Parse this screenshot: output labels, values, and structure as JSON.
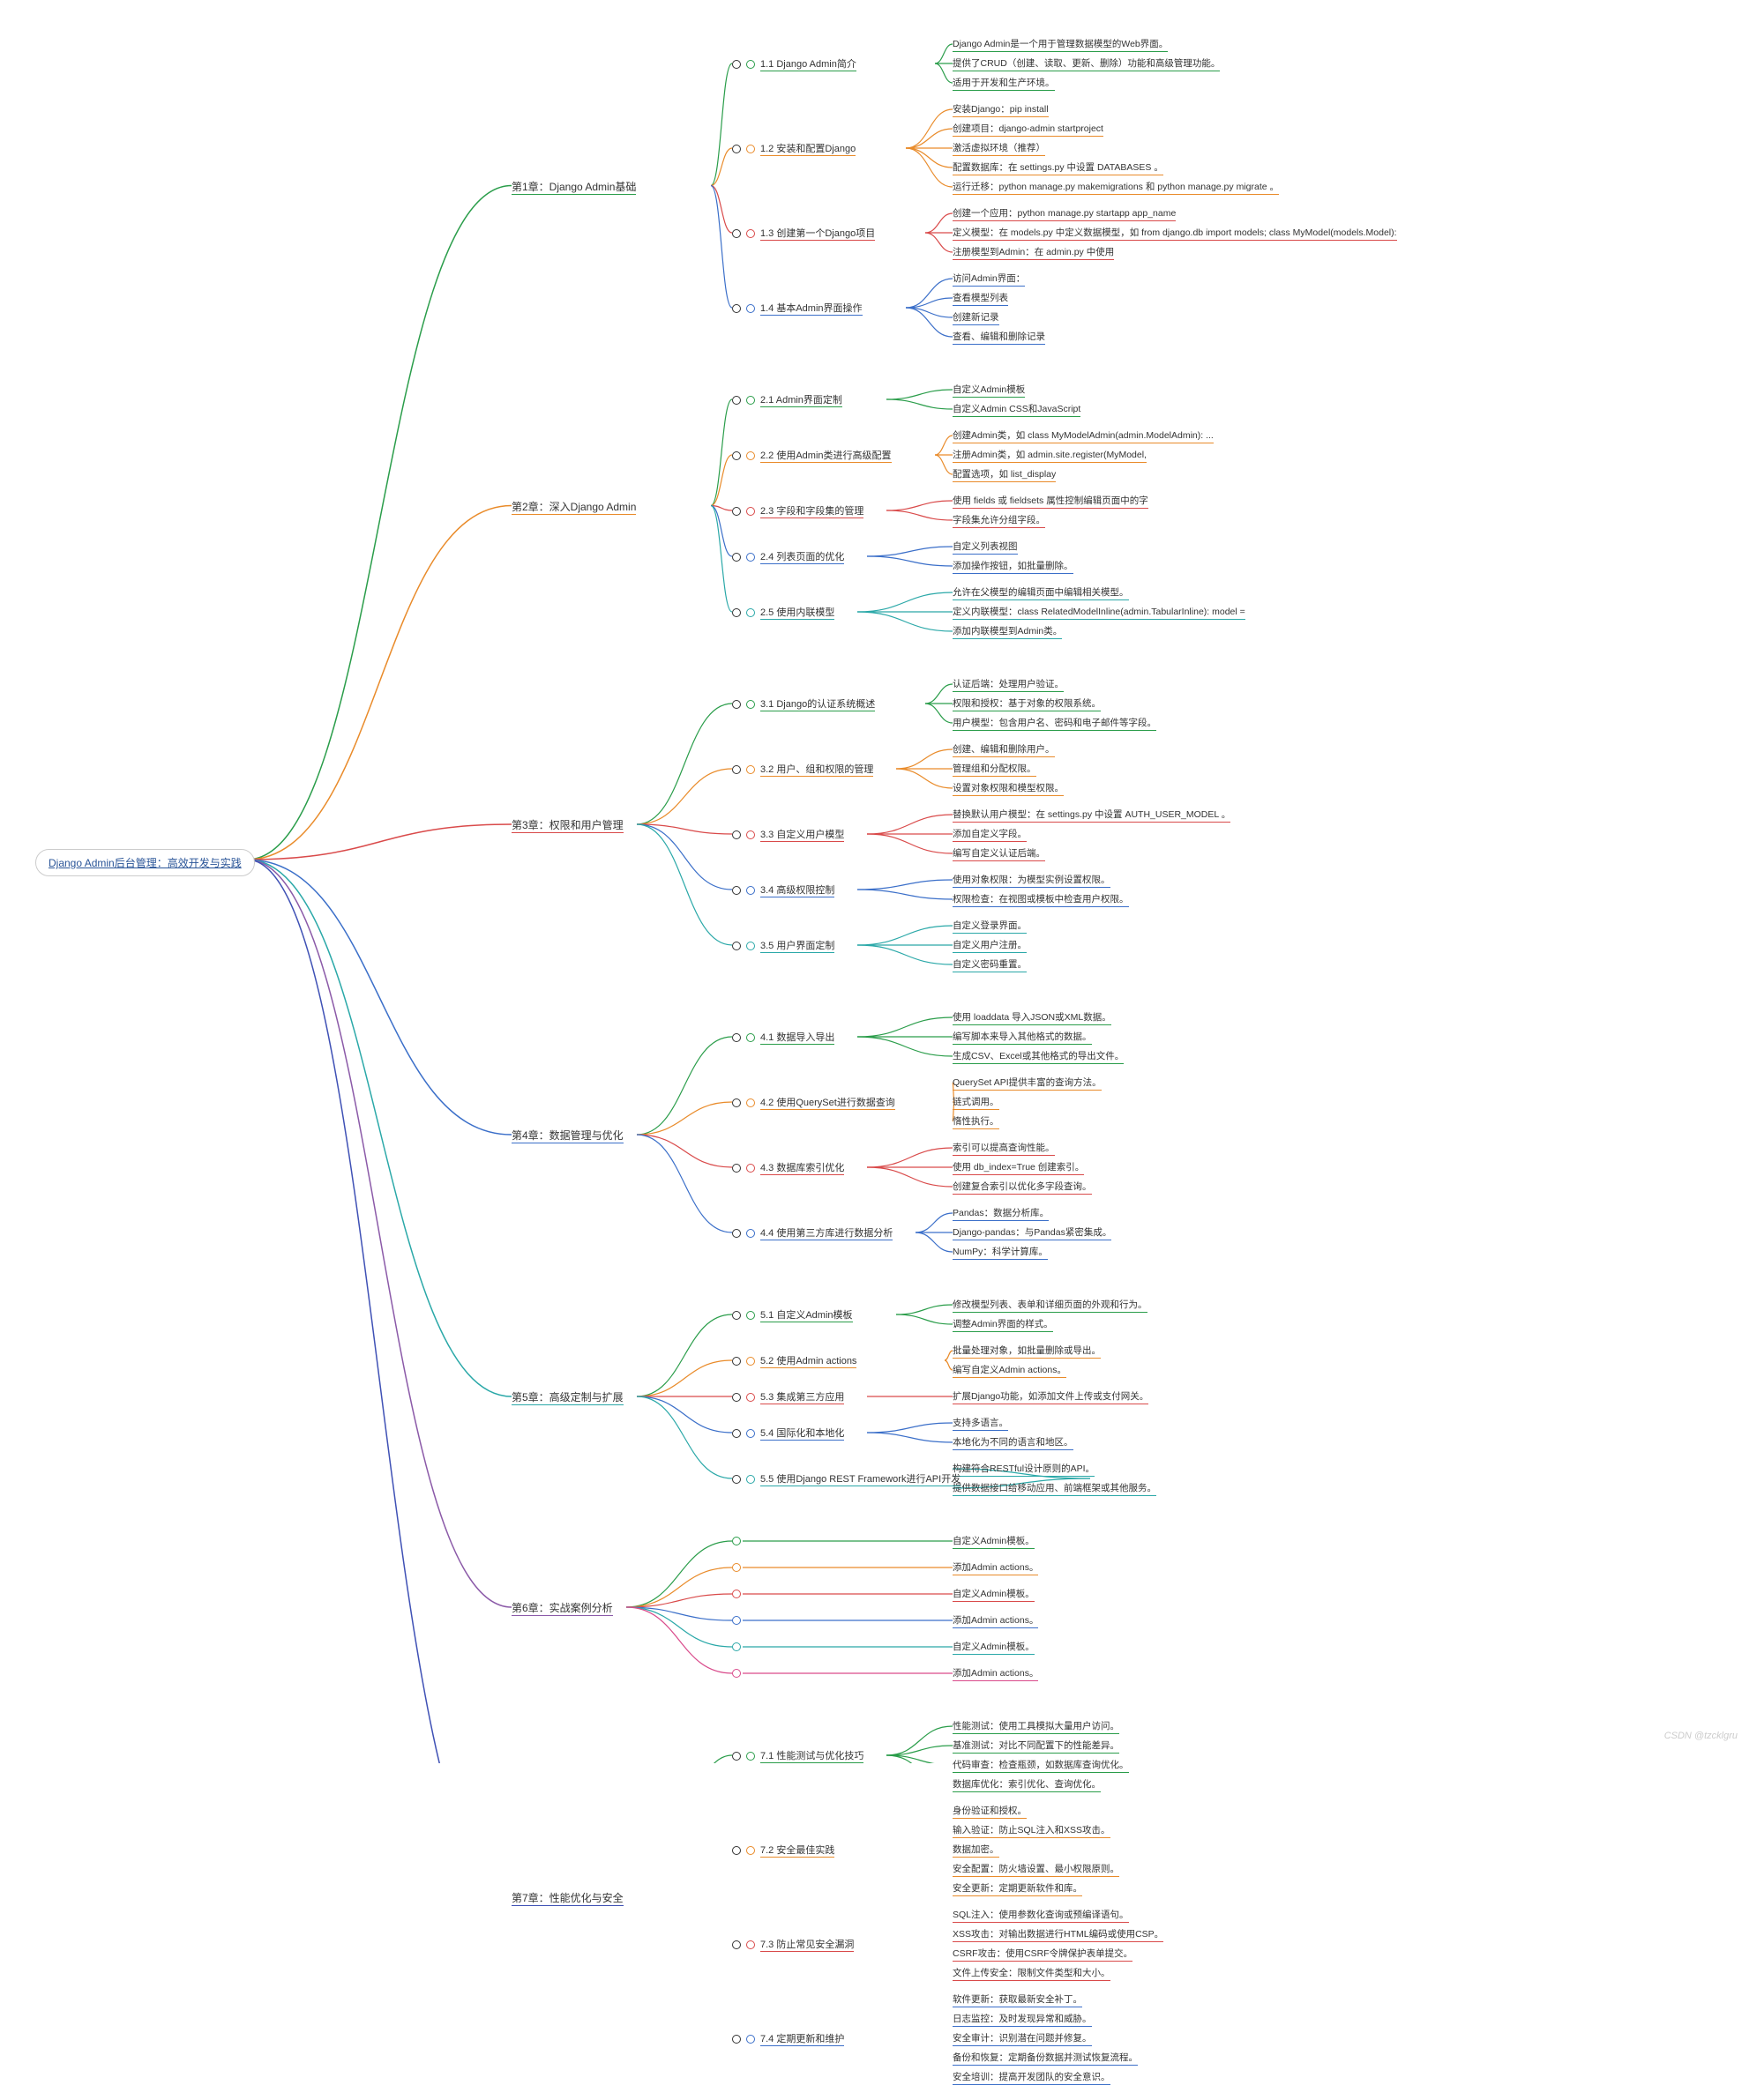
{
  "root": "Django Admin后台管理：高效开发与实践",
  "watermark": "CSDN @tzcklgru",
  "chapters": [
    {
      "label": "第1章：Django Admin基础",
      "color": "c-green",
      "sections": [
        {
          "label": "1.1 Django Admin简介",
          "color": "c-green",
          "leaves": [
            "Django Admin是一个用于管理数据模型的Web界面。",
            "提供了CRUD（创建、读取、更新、删除）功能和高级管理功能。",
            "适用于开发和生产环境。"
          ]
        },
        {
          "label": "1.2 安装和配置Django",
          "color": "c-orange",
          "leaves": [
            "安装Django：pip install",
            "创建项目：django-admin startproject",
            "激活虚拟环境（推荐）",
            "配置数据库：在 settings.py 中设置 DATABASES 。",
            "运行迁移：python manage.py makemigrations 和 python manage.py migrate 。"
          ]
        },
        {
          "label": "1.3 创建第一个Django项目",
          "color": "c-red",
          "leaves": [
            "创建一个应用：python manage.py startapp app_name",
            "定义模型：在 models.py 中定义数据模型，如 from django.db import models; class MyModel(models.Model):",
            "注册模型到Admin：在 admin.py 中使用"
          ]
        },
        {
          "label": "1.4 基本Admin界面操作",
          "color": "c-blue",
          "leaves": [
            "访问Admin界面：",
            "查看模型列表",
            "创建新记录",
            "查看、编辑和删除记录"
          ]
        }
      ]
    },
    {
      "label": "第2章：深入Django Admin",
      "color": "c-orange",
      "sections": [
        {
          "label": "2.1 Admin界面定制",
          "color": "c-green",
          "leaves": [
            "自定义Admin模板",
            "自定义Admin CSS和JavaScript"
          ]
        },
        {
          "label": "2.2 使用Admin类进行高级配置",
          "color": "c-orange",
          "leaves": [
            "创建Admin类，如 class MyModelAdmin(admin.ModelAdmin): ...",
            "注册Admin类，如 admin.site.register(MyModel,",
            "配置选项，如 list_display"
          ]
        },
        {
          "label": "2.3 字段和字段集的管理",
          "color": "c-red",
          "leaves": [
            "使用 fields 或 fieldsets 属性控制编辑页面中的字",
            "字段集允许分组字段。"
          ]
        },
        {
          "label": "2.4 列表页面的优化",
          "color": "c-blue",
          "leaves": [
            "自定义列表视图",
            "添加操作按钮，如批量删除。"
          ]
        },
        {
          "label": "2.5 使用内联模型",
          "color": "c-cyan",
          "leaves": [
            "允许在父模型的编辑页面中编辑相关模型。",
            "定义内联模型：class RelatedModelInline(admin.TabularInline): model =",
            "添加内联模型到Admin类。"
          ]
        }
      ]
    },
    {
      "label": "第3章：权限和用户管理",
      "color": "c-red",
      "sections": [
        {
          "label": "3.1 Django的认证系统概述",
          "color": "c-green",
          "leaves": [
            "认证后端：处理用户验证。",
            "权限和授权：基于对象的权限系统。",
            "用户模型：包含用户名、密码和电子邮件等字段。"
          ]
        },
        {
          "label": "3.2 用户、组和权限的管理",
          "color": "c-orange",
          "leaves": [
            "创建、编辑和删除用户。",
            "管理组和分配权限。",
            "设置对象权限和模型权限。"
          ]
        },
        {
          "label": "3.3 自定义用户模型",
          "color": "c-red",
          "leaves": [
            "替换默认用户模型：在 settings.py 中设置 AUTH_USER_MODEL 。",
            "添加自定义字段。",
            "编写自定义认证后端。"
          ]
        },
        {
          "label": "3.4 高级权限控制",
          "color": "c-blue",
          "leaves": [
            "使用对象权限：为模型实例设置权限。",
            "权限检查：在视图或模板中检查用户权限。"
          ]
        },
        {
          "label": "3.5 用户界面定制",
          "color": "c-cyan",
          "leaves": [
            "自定义登录界面。",
            "自定义用户注册。",
            "自定义密码重置。"
          ]
        }
      ]
    },
    {
      "label": "第4章：数据管理与优化",
      "color": "c-blue",
      "sections": [
        {
          "label": "4.1 数据导入导出",
          "color": "c-green",
          "leaves": [
            "使用 loaddata 导入JSON或XML数据。",
            "编写脚本来导入其他格式的数据。",
            "生成CSV、Excel或其他格式的导出文件。"
          ]
        },
        {
          "label": "4.2 使用QuerySet进行数据查询",
          "color": "c-orange",
          "leaves": [
            "QuerySet API提供丰富的查询方法。",
            "链式调用。",
            "惰性执行。"
          ]
        },
        {
          "label": "4.3 数据库索引优化",
          "color": "c-red",
          "leaves": [
            "索引可以提高查询性能。",
            "使用 db_index=True 创建索引。",
            "创建复合索引以优化多字段查询。"
          ]
        },
        {
          "label": "4.4 使用第三方库进行数据分析",
          "color": "c-blue",
          "leaves": [
            "Pandas：数据分析库。",
            "Django-pandas：与Pandas紧密集成。",
            "NumPy：科学计算库。"
          ]
        }
      ]
    },
    {
      "label": "第5章：高级定制与扩展",
      "color": "c-cyan",
      "sections": [
        {
          "label": "5.1 自定义Admin模板",
          "color": "c-green",
          "leaves": [
            "修改模型列表、表单和详细页面的外观和行为。",
            "调整Admin界面的样式。"
          ]
        },
        {
          "label": "5.2 使用Admin actions",
          "color": "c-orange",
          "leaves": [
            "批量处理对象，如批量删除或导出。",
            "编写自定义Admin actions。"
          ]
        },
        {
          "label": "5.3 集成第三方应用",
          "color": "c-red",
          "leaves": [
            "扩展Django功能，如添加文件上传或支付网关。"
          ]
        },
        {
          "label": "5.4 国际化和本地化",
          "color": "c-blue",
          "leaves": [
            "支持多语言。",
            "本地化为不同的语言和地区。"
          ]
        },
        {
          "label": "5.5 使用Django REST Framework进行API开发",
          "color": "c-cyan",
          "leaves": [
            "构建符合RESTful设计原则的API。",
            "提供数据接口给移动应用、前端框架或其他服务。"
          ]
        }
      ]
    },
    {
      "label": "第6章：实战案例分析",
      "color": "c-purple",
      "sections": [
        {
          "label": "",
          "color": "c-green",
          "leaves": [
            "自定义Admin模板。"
          ]
        },
        {
          "label": "",
          "color": "c-orange",
          "leaves": [
            "添加Admin actions。"
          ]
        },
        {
          "label": "",
          "color": "c-red",
          "leaves": [
            "自定义Admin模板。"
          ]
        },
        {
          "label": "",
          "color": "c-blue",
          "leaves": [
            "添加Admin actions。"
          ]
        },
        {
          "label": "",
          "color": "c-cyan",
          "leaves": [
            "自定义Admin模板。"
          ]
        },
        {
          "label": "",
          "color": "c-pink",
          "leaves": [
            "添加Admin actions。"
          ]
        }
      ]
    },
    {
      "label": "第7章：性能优化与安全",
      "color": "c-navy",
      "sections": [
        {
          "label": "7.1 性能测试与优化技巧",
          "color": "c-green",
          "leaves": [
            "性能测试：使用工具模拟大量用户访问。",
            "基准测试：对比不同配置下的性能差异。",
            "代码审查：检查瓶颈，如数据库查询优化。",
            "数据库优化：索引优化、查询优化。"
          ]
        },
        {
          "label": "7.2 安全最佳实践",
          "color": "c-orange",
          "leaves": [
            "身份验证和授权。",
            "输入验证：防止SQL注入和XSS攻击。",
            "数据加密。",
            "安全配置：防火墙设置、最小权限原则。",
            "安全更新：定期更新软件和库。"
          ]
        },
        {
          "label": "7.3 防止常见安全漏洞",
          "color": "c-red",
          "leaves": [
            "SQL注入：使用参数化查询或预编译语句。",
            "XSS攻击：对输出数据进行HTML编码或使用CSP。",
            "CSRF攻击：使用CSRF令牌保护表单提交。",
            "文件上传安全：限制文件类型和大小。"
          ]
        },
        {
          "label": "7.4 定期更新和维护",
          "color": "c-blue",
          "leaves": [
            "软件更新：获取最新安全补丁。",
            "日志监控：及时发现异常和威胁。",
            "安全审计：识别潜在问题并修复。",
            "备份和恢复：定期备份数据并测试恢复流程。",
            "安全培训：提高开发团队的安全意识。"
          ]
        }
      ]
    }
  ]
}
